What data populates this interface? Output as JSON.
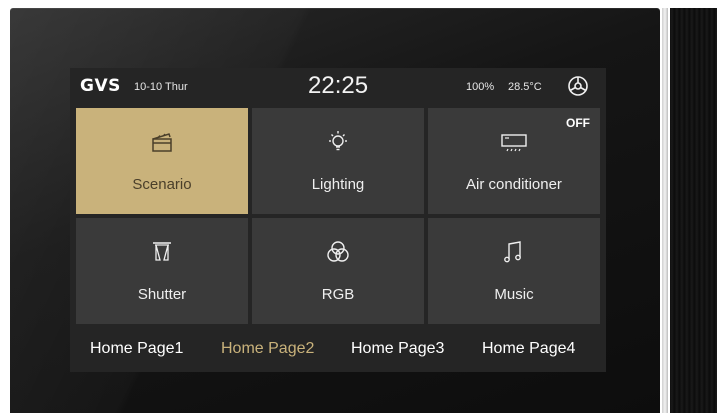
{
  "status": {
    "brand": "GVS",
    "date": "10-10 Thur",
    "time": "22:25",
    "battery": "100%",
    "temperature": "28.5°C"
  },
  "tiles": [
    {
      "label": "Scenario",
      "icon": "clapperboard-icon",
      "active": true
    },
    {
      "label": "Lighting",
      "icon": "lightbulb-icon"
    },
    {
      "label": "Air conditioner",
      "icon": "air-conditioner-icon",
      "badge": "OFF"
    },
    {
      "label": "Shutter",
      "icon": "shutter-icon"
    },
    {
      "label": "RGB",
      "icon": "rgb-circles-icon"
    },
    {
      "label": "Music",
      "icon": "music-note-icon"
    }
  ],
  "pages": [
    {
      "label": "Home Page1"
    },
    {
      "label": "Home Page2",
      "selected": true
    },
    {
      "label": "Home Page3"
    },
    {
      "label": "Home Page4"
    }
  ],
  "colors": {
    "accent": "#c9b27b",
    "tile": "#3a3a3a",
    "screen": "#252525"
  }
}
